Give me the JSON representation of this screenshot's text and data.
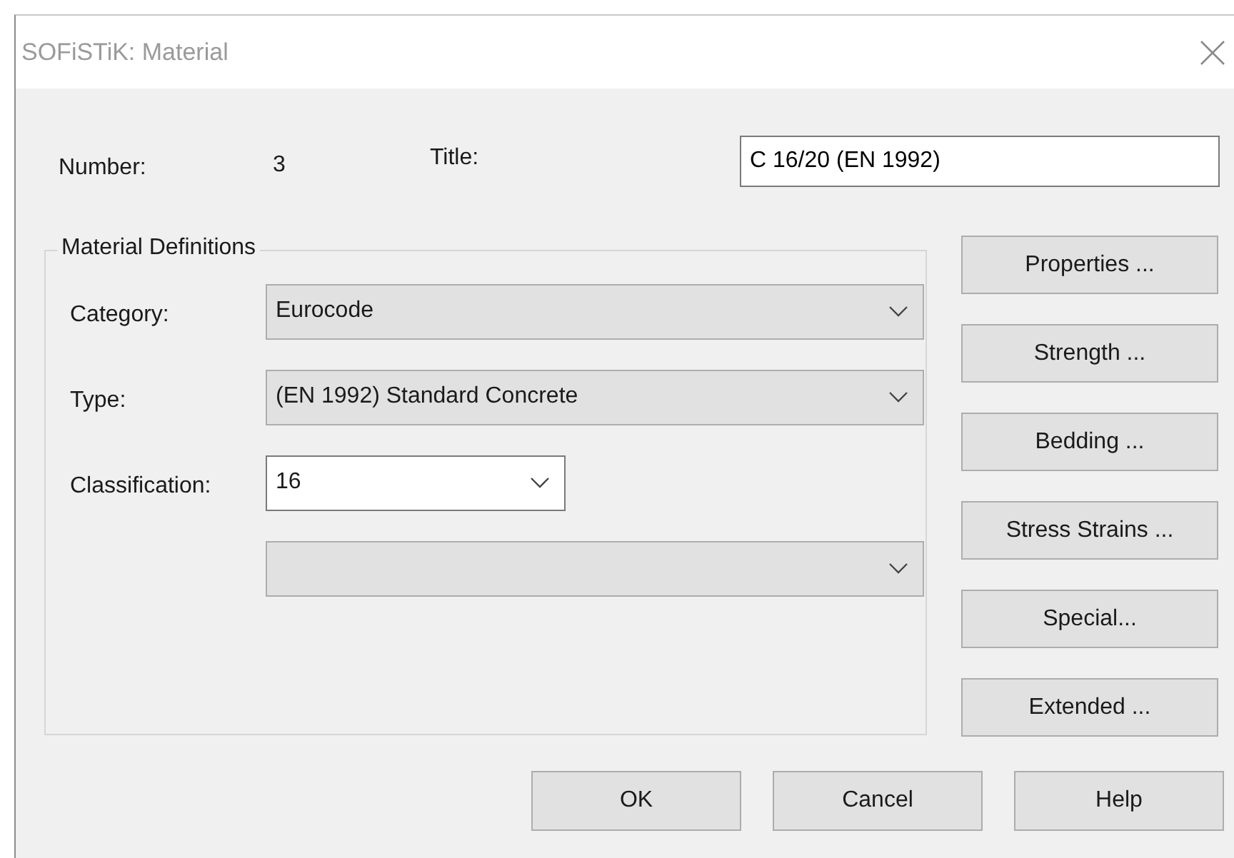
{
  "window": {
    "title": "SOFiSTiK: Material"
  },
  "number": {
    "label": "Number:",
    "value": "3"
  },
  "title_field": {
    "label": "Title:",
    "value": "C 16/20 (EN 1992)"
  },
  "material_definitions": {
    "legend": "Material Definitions",
    "fields": [
      {
        "label": "Category:",
        "kind": "list",
        "value": "Eurocode"
      },
      {
        "label": "Type:",
        "kind": "list",
        "value": "(EN 1992) Standard Concrete"
      },
      {
        "label": "Classification:",
        "kind": "edit",
        "value": "16"
      },
      {
        "kind": "list"
      }
    ]
  },
  "side_buttons": [
    "Properties ...",
    "Strength ...",
    "Bedding ...",
    "Stress Strains ...",
    "Special...",
    "Extended ..."
  ],
  "buttons": [
    "OK",
    "Cancel",
    "Help"
  ]
}
